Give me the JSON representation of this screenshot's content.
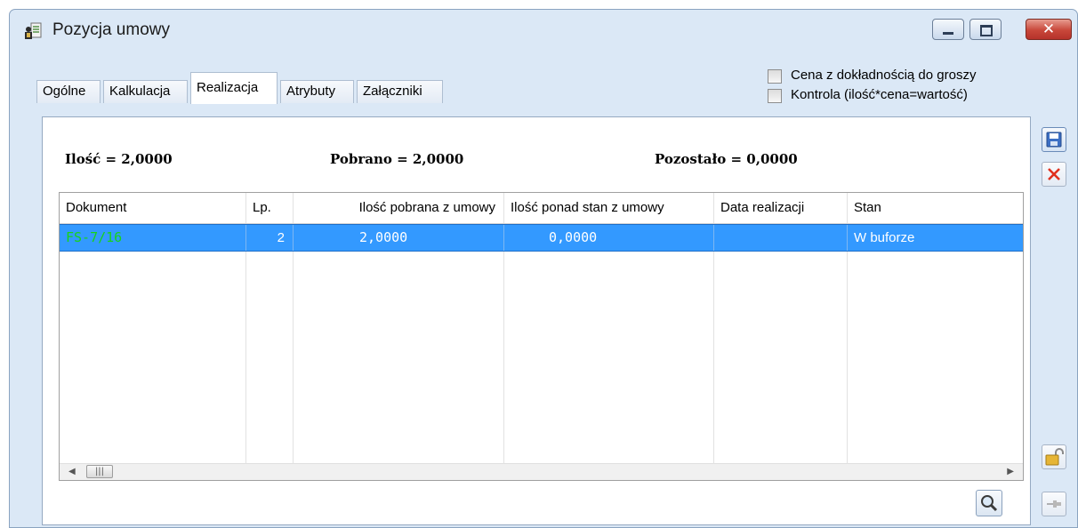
{
  "window": {
    "title": "Pozycja umowy"
  },
  "tabs": [
    {
      "label": "Ogólne"
    },
    {
      "label": "Kalkulacja"
    },
    {
      "label": "Realizacja"
    },
    {
      "label": "Atrybuty"
    },
    {
      "label": "Załączniki"
    }
  ],
  "options": {
    "price_precision": {
      "label": "Cena z dokładnością do groszy",
      "checked": false
    },
    "control": {
      "label": "Kontrola (ilość*cena=wartość)",
      "checked": false
    }
  },
  "summary": {
    "ilosc": "Ilość = 2,0000",
    "pobrano": "Pobrano = 2,0000",
    "pozostalo": "Pozostało = 0,0000"
  },
  "grid": {
    "columns": [
      "Dokument",
      "Lp.",
      "Ilość pobrana z umowy",
      "Ilość ponad stan z umowy",
      "Data realizacji",
      "Stan"
    ],
    "rows": [
      {
        "dokument": "FS-7/16",
        "lp": "2",
        "ilosc_pobrana": "2,0000",
        "ilosc_ponad": "0,0000",
        "data": "",
        "stan": "W buforze"
      }
    ]
  },
  "icons": {
    "window": "document-icon",
    "save": "save-icon",
    "delete": "delete-icon",
    "lock": "unlock-icon",
    "pin": "pin-icon",
    "search": "search-icon"
  },
  "colors": {
    "selection": "#3399ff",
    "document_link": "#18d318",
    "delete": "#e0301e"
  }
}
